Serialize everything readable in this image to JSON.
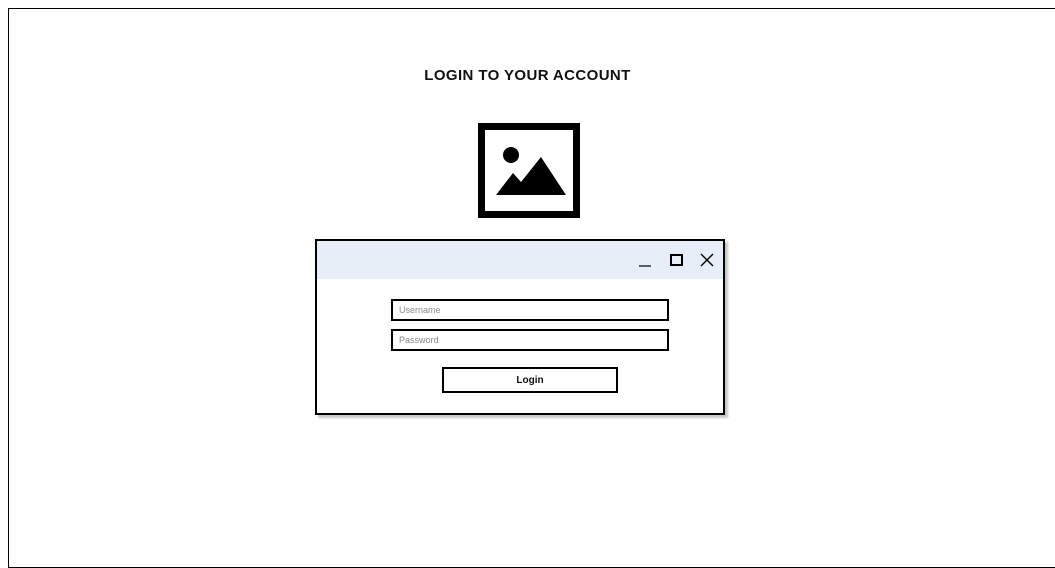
{
  "page": {
    "title": "LOGIN TO YOUR ACCOUNT"
  },
  "image_placeholder": {
    "icon": "image-icon"
  },
  "window": {
    "controls": [
      "minimize-icon",
      "maximize-icon",
      "close-icon"
    ]
  },
  "form": {
    "username_placeholder": "Username",
    "username_value": "",
    "password_placeholder": "Password",
    "password_value": "",
    "login_label": "Login"
  },
  "colors": {
    "titlebar": "#e8eef8",
    "border": "#000000",
    "background": "#ffffff"
  }
}
